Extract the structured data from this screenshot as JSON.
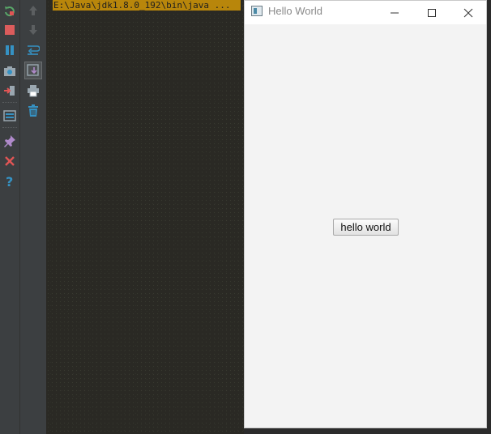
{
  "console": {
    "command": "E:\\Java\\jdk1.8.0_192\\bin\\java ..."
  },
  "toolbar_left": {
    "icons": [
      "rerun-icon",
      "stop-icon",
      "pause-icon",
      "camera-icon",
      "exit-icon",
      "layout-icon",
      "pin-icon",
      "close-icon",
      "help-icon"
    ]
  },
  "toolbar_second": {
    "icons": [
      "up-arrow-icon",
      "down-arrow-icon",
      "soft-wrap-icon",
      "scroll-to-end-icon",
      "print-icon",
      "trash-icon"
    ]
  },
  "window": {
    "title": "Hello World",
    "button_label": "hello world"
  },
  "colors": {
    "console_highlight": "#b8860b",
    "ide_toolbar": "#3c3f41",
    "window_bg": "#f3f3f3"
  }
}
